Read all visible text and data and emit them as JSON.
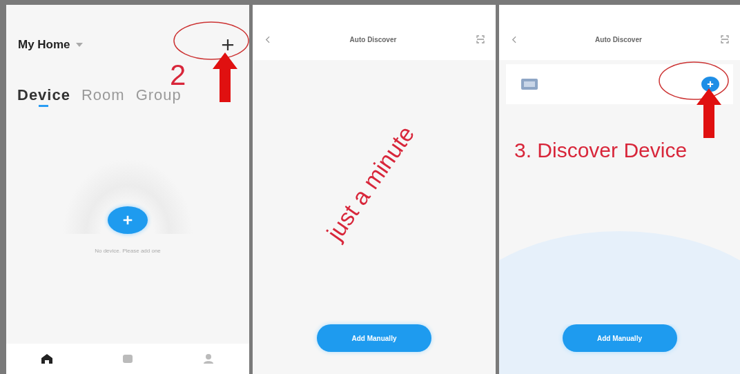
{
  "home_screen": {
    "title": "My Home",
    "tabs": [
      {
        "label": "Device",
        "selected": true
      },
      {
        "label": "Room",
        "selected": false
      },
      {
        "label": "Group",
        "selected": false
      }
    ],
    "empty_message": "No device. Please add one",
    "nav": [
      {
        "selected": true
      },
      {
        "selected": false
      },
      {
        "selected": false
      }
    ]
  },
  "discover_screen": {
    "title": "Auto Discover",
    "button": "Add Manually"
  },
  "result_screen": {
    "title": "Auto Discover",
    "button": "Add Manually"
  },
  "annotations": [
    {
      "kind": "step",
      "text": "2"
    },
    {
      "kind": "note",
      "text": "just a minute"
    },
    {
      "kind": "step",
      "text": "3. Discover Device"
    }
  ]
}
